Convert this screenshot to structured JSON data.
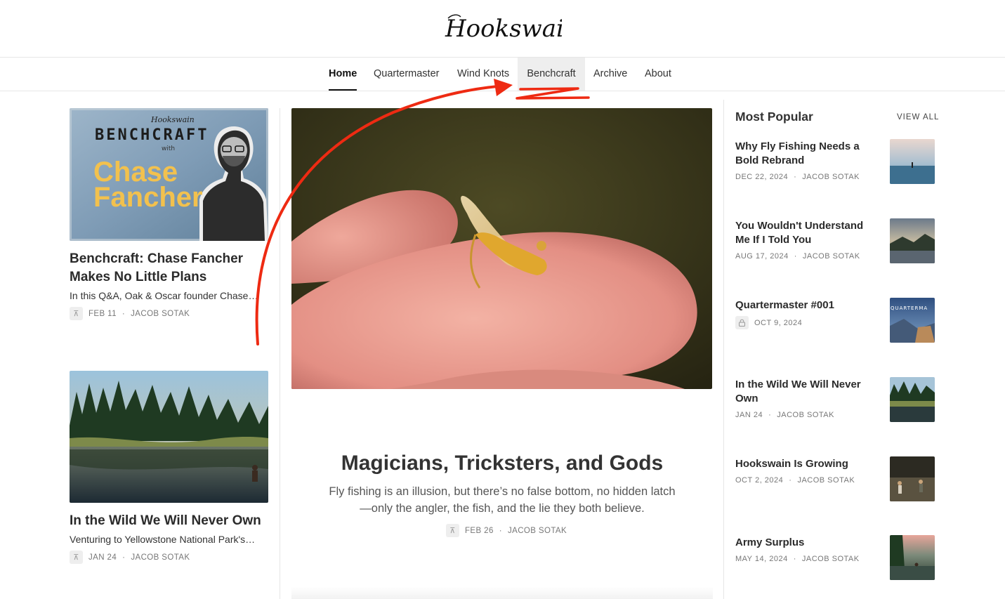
{
  "site": {
    "logo_text": "Hookswain"
  },
  "nav": {
    "items": [
      {
        "label": "Home",
        "active": true
      },
      {
        "label": "Quartermaster"
      },
      {
        "label": "Wind Knots"
      },
      {
        "label": "Benchcraft",
        "hover": true
      },
      {
        "label": "Archive"
      },
      {
        "label": "About"
      }
    ]
  },
  "left_posts": [
    {
      "image_text": {
        "brand": "Hookswain",
        "series": "BENCHCRAFT",
        "with": "with",
        "name_line1": "Chase",
        "name_line2": "Fancher"
      },
      "title": "Benchcraft: Chase Fancher Makes No Little Plans",
      "subtitle": "In this Q&A, Oak & Oscar founder Chase…",
      "date": "FEB 11",
      "author": "JACOB SOTAK",
      "icon": "pin-icon"
    },
    {
      "title": "In the Wild We Will Never Own",
      "subtitle": "Venturing to Yellowstone National Park's…",
      "date": "JAN 24",
      "author": "JACOB SOTAK",
      "icon": "pin-icon"
    }
  ],
  "featured": {
    "title": "Magicians, Tricksters, and Gods",
    "subtitle": "Fly fishing is an illusion, but there’s no false bottom, no hidden latch—only the angler, the fish, and the lie they both believe.",
    "date": "FEB 26",
    "author": "JACOB SOTAK",
    "icon": "pin-icon"
  },
  "popular": {
    "heading": "Most Popular",
    "view_all": "VIEW ALL",
    "items": [
      {
        "title": "Why Fly Fishing Needs a Bold Rebrand",
        "date": "DEC 22, 2024",
        "author": "JACOB SOTAK"
      },
      {
        "title": "You Wouldn't Understand Me If I Told You",
        "date": "AUG 17, 2024",
        "author": "JACOB SOTAK"
      },
      {
        "title": "Quartermaster #001",
        "date": "OCT 9, 2024",
        "author": "",
        "locked": true,
        "thumb_text": "QUARTERMA"
      },
      {
        "title": "In the Wild We Will Never Own",
        "date": "JAN 24",
        "author": "JACOB SOTAK"
      },
      {
        "title": "Hookswain Is Growing",
        "date": "OCT 2, 2024",
        "author": "JACOB SOTAK"
      },
      {
        "title": "Army Surplus",
        "date": "MAY 14, 2024",
        "author": "JACOB SOTAK"
      }
    ]
  },
  "separator": "·",
  "colors": {
    "annotation": "#ee2a12",
    "accent_yellow": "#f2c14e",
    "text": "#2b2b2b",
    "muted": "#777777"
  }
}
